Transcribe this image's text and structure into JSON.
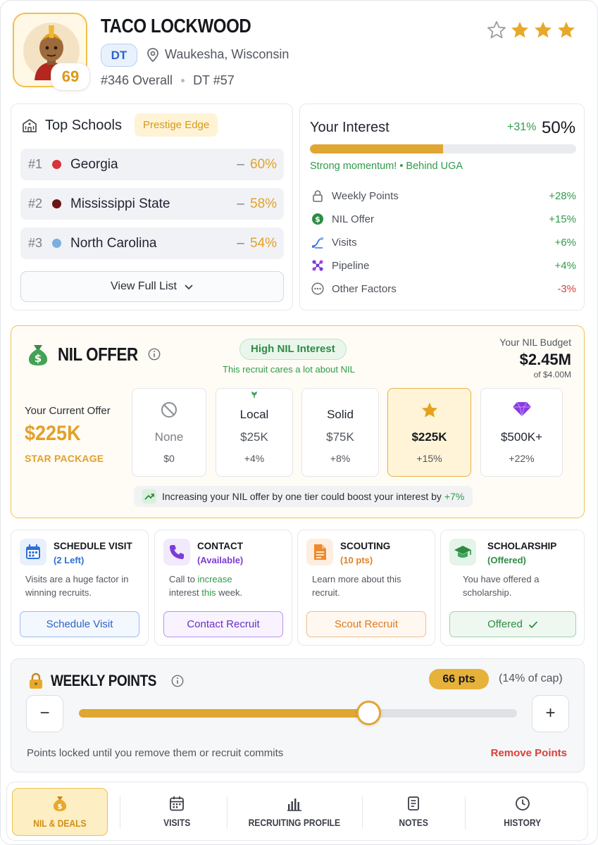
{
  "player": {
    "name": "TACO LOCKWOOD",
    "ovr": "69",
    "position": "DT",
    "location": "Waukesha, Wisconsin",
    "overall_rank": "#346 Overall",
    "position_rank": "DT #57",
    "stars_total": 4,
    "stars_filled": 3
  },
  "top_schools": {
    "title": "Top Schools",
    "badge": "Prestige Edge",
    "rows": [
      {
        "rank": "#1",
        "name": "Georgia",
        "dash": "–",
        "pct": "60%",
        "color": "#d8323b"
      },
      {
        "rank": "#2",
        "name": "Mississippi State",
        "dash": "–",
        "pct": "58%",
        "color": "#6e1414"
      },
      {
        "rank": "#3",
        "name": "North Carolina",
        "dash": "–",
        "pct": "54%",
        "color": "#7bafe0"
      }
    ],
    "view_full": "View Full List"
  },
  "interest": {
    "title": "Your Interest",
    "delta": "+31%",
    "value": "50%",
    "fill": 0.5,
    "note": "Strong momentum! • Behind UGA",
    "factors": [
      {
        "label": "Weekly Points",
        "value": "+28%",
        "icon": "lock-icon",
        "color": "#2f9b4a"
      },
      {
        "label": "NIL Offer",
        "value": "+15%",
        "icon": "dollar-icon",
        "color": "#2f9b4a"
      },
      {
        "label": "Visits",
        "value": "+6%",
        "icon": "visits-icon",
        "color": "#2f9b4a"
      },
      {
        "label": "Pipeline",
        "value": "+4%",
        "icon": "pipeline-icon",
        "color": "#2f9b4a"
      },
      {
        "label": "Other Factors",
        "value": "-3%",
        "icon": "more-icon",
        "color": "#d8403a"
      }
    ]
  },
  "nil": {
    "title": "NIL OFFER",
    "interest_badge": "High NIL Interest",
    "interest_sub": "This recruit cares a lot about NIL",
    "budget_label": "Your NIL Budget",
    "budget_value": "$2.45M",
    "budget_of": "of $4.00M",
    "current_label": "Your Current Offer",
    "current_value": "$225K",
    "current_package": "STAR PACKAGE",
    "tiers": [
      {
        "name": "",
        "price": "None",
        "boost": "$0",
        "icon": "none-icon"
      },
      {
        "name": "Local",
        "price": "$25K",
        "boost": "+4%",
        "icon": "sprout-icon"
      },
      {
        "name": "Solid",
        "price": "$75K",
        "boost": "+8%",
        "icon": ""
      },
      {
        "name": "",
        "price": "$225K",
        "boost": "+15%",
        "icon": "star-icon"
      },
      {
        "name": "",
        "price": "$500K+",
        "boost": "+22%",
        "icon": "diamond-icon"
      }
    ],
    "boost_text": "Increasing your NIL offer by one tier could boost your interest by",
    "boost_value": "+7%"
  },
  "actions": [
    {
      "title": "SCHEDULE VISIT",
      "sub": "(2 Left)",
      "desc": "Visits are a huge factor in winning recruits.",
      "button": "Schedule Visit"
    },
    {
      "title": "CONTACT",
      "sub": "(Available)",
      "desc_a": "Call to",
      "desc_b": "increase",
      "desc_c": "interest",
      "desc_d": "this",
      "desc_e": "week.",
      "button": "Contact Recruit"
    },
    {
      "title": "SCOUTING",
      "sub": "(10 pts)",
      "desc": "Learn more about this recruit.",
      "button": "Scout Recruit"
    },
    {
      "title": "SCHOLARSHIP",
      "sub": "(Offered)",
      "desc": "You have offered a scholarship.",
      "button": "Offered"
    }
  ],
  "weekly": {
    "title": "WEEKLY POINTS",
    "points": "66 pts",
    "cap": "(14% of cap)",
    "fill": 0.66,
    "minus": "−",
    "plus": "+",
    "locked_note": "Points locked until you remove them or recruit commits",
    "remove": "Remove Points"
  },
  "nav": [
    {
      "label": "NIL & DEALS",
      "icon": "moneybag-icon"
    },
    {
      "label": "VISITS",
      "icon": "calendar-icon"
    },
    {
      "label": "RECRUITING PROFILE",
      "icon": "bars-icon"
    },
    {
      "label": "NOTES",
      "icon": "notes-icon"
    },
    {
      "label": "HISTORY",
      "icon": "clock-icon"
    }
  ]
}
